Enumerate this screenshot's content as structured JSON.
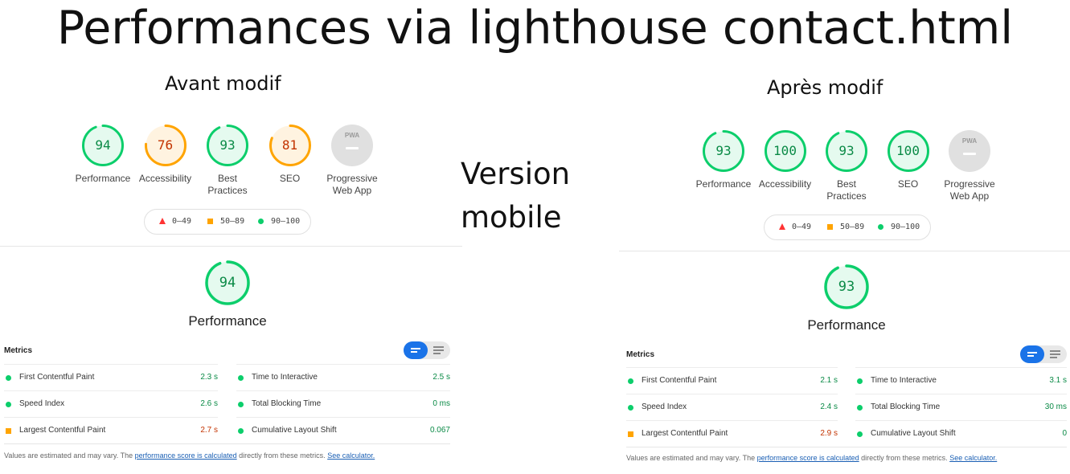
{
  "title": "Performances via lighthouse contact.html",
  "middle_label": [
    "Version",
    "mobile"
  ],
  "colors": {
    "pass": "#0cce6b",
    "average": "#ffa400",
    "fail": "#ff3333",
    "accent": "#1a73e8"
  },
  "legend": {
    "fail": "0–49",
    "average": "50–89",
    "pass": "90–100"
  },
  "icons": {
    "pwa": "PWA",
    "toggle": "list-view-toggle-icon"
  },
  "before": {
    "label": "Avant modif",
    "gauges": [
      {
        "score": "94",
        "label": "Performance",
        "status": "pass"
      },
      {
        "score": "76",
        "label": "Accessibility",
        "status": "average"
      },
      {
        "score": "93",
        "label": "Best Practices",
        "status": "pass"
      },
      {
        "score": "81",
        "label": "SEO",
        "status": "average"
      },
      {
        "score": "",
        "label": "Progressive Web App",
        "status": "pwa"
      }
    ],
    "performance_score": "94",
    "performance_label": "Performance",
    "metrics_heading": "Metrics",
    "metrics_left": [
      {
        "name": "First Contentful Paint",
        "value": "2.3 s",
        "status": "pass"
      },
      {
        "name": "Speed Index",
        "value": "2.6 s",
        "status": "pass"
      },
      {
        "name": "Largest Contentful Paint",
        "value": "2.7 s",
        "status": "average"
      }
    ],
    "metrics_right": [
      {
        "name": "Time to Interactive",
        "value": "2.5 s",
        "status": "pass"
      },
      {
        "name": "Total Blocking Time",
        "value": "0 ms",
        "status": "pass"
      },
      {
        "name": "Cumulative Layout Shift",
        "value": "0.067",
        "status": "pass"
      }
    ],
    "note": {
      "prefix": "Values are estimated and may vary. The ",
      "link1": "performance score is calculated",
      "middle": " directly from these metrics. ",
      "link2": "See calculator."
    }
  },
  "after": {
    "label": "Après modif",
    "gauges": [
      {
        "score": "93",
        "label": "Performance",
        "status": "pass"
      },
      {
        "score": "100",
        "label": "Accessibility",
        "status": "pass"
      },
      {
        "score": "93",
        "label": "Best Practices",
        "status": "pass"
      },
      {
        "score": "100",
        "label": "SEO",
        "status": "pass"
      },
      {
        "score": "",
        "label": "Progressive Web App",
        "status": "pwa"
      }
    ],
    "performance_score": "93",
    "performance_label": "Performance",
    "metrics_heading": "Metrics",
    "metrics_left": [
      {
        "name": "First Contentful Paint",
        "value": "2.1 s",
        "status": "pass"
      },
      {
        "name": "Speed Index",
        "value": "2.4 s",
        "status": "pass"
      },
      {
        "name": "Largest Contentful Paint",
        "value": "2.9 s",
        "status": "average"
      }
    ],
    "metrics_right": [
      {
        "name": "Time to Interactive",
        "value": "3.1 s",
        "status": "pass"
      },
      {
        "name": "Total Blocking Time",
        "value": "30 ms",
        "status": "pass"
      },
      {
        "name": "Cumulative Layout Shift",
        "value": "0",
        "status": "pass"
      }
    ],
    "note": {
      "prefix": "Values are estimated and may vary. The ",
      "link1": "performance score is calculated",
      "middle": " directly from these metrics. ",
      "link2": "See calculator."
    }
  }
}
